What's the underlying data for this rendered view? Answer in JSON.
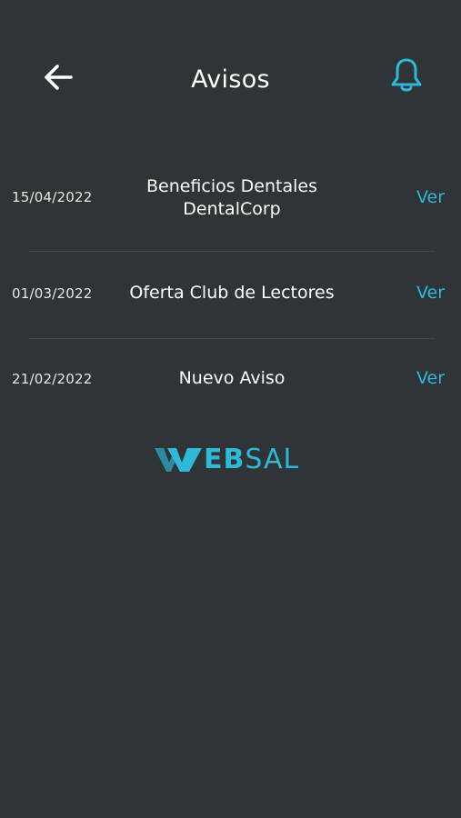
{
  "header": {
    "title": "Avisos"
  },
  "notices": [
    {
      "date": "15/04/2022",
      "subject_line1": "Beneficios Dentales",
      "subject_line2": "DentalCorp",
      "action": "Ver"
    },
    {
      "date": "01/03/2022",
      "subject": "Oferta Club de Lectores",
      "action": "Ver"
    },
    {
      "date": "21/02/2022",
      "subject": "Nuevo Aviso",
      "action": "Ver"
    }
  ],
  "logo": {
    "text_bold": "EB",
    "text_light": "SAL",
    "brand_color": "#2fb8d8"
  },
  "icons": {
    "back": "arrow-left-icon",
    "notifications": "bell-icon"
  },
  "colors": {
    "background": "#2f3436",
    "accent": "#2fb8d8",
    "text": "#ffffff"
  }
}
